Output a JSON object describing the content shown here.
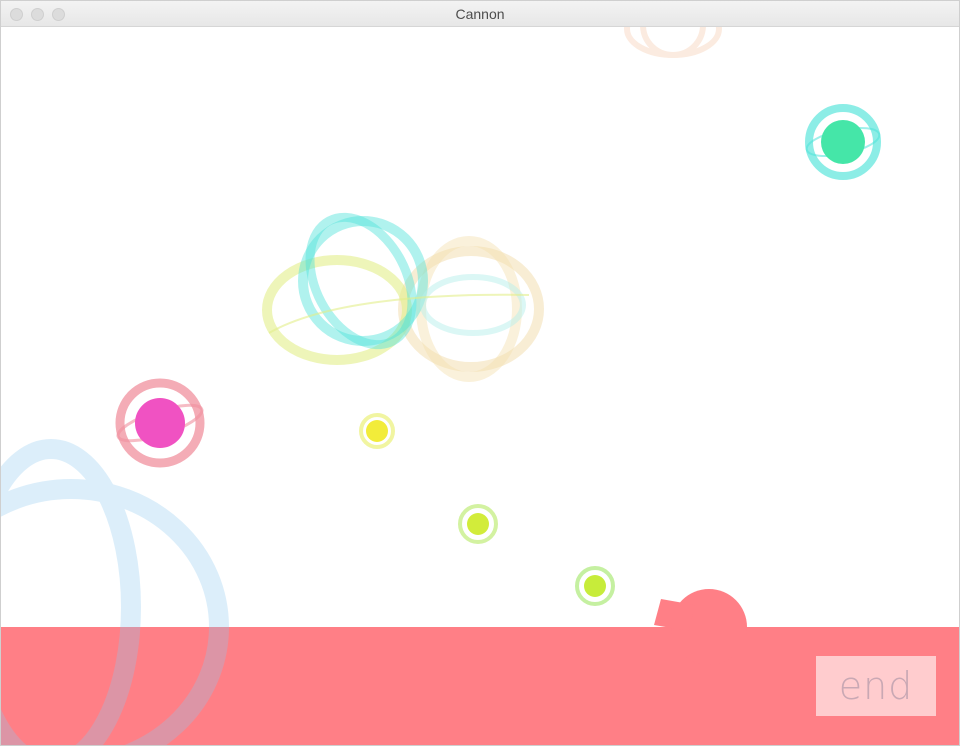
{
  "window": {
    "title": "Cannon"
  },
  "controls": {
    "end_label": "end"
  },
  "colors": {
    "ground": "#ff7f86",
    "cannon": "#ff7f86",
    "teal": "#45e6a8",
    "magenta": "#f052c2",
    "yellow": "#f2ec3a",
    "lime": "#d2ec3a",
    "aqua_ring": "#4fe3d9",
    "pink_ring": "#f0909e",
    "sky_ring": "#8fcaf0",
    "cream_ring": "#f3dfb0",
    "pale_yellow_ring": "#e2ef8a",
    "peach_ring": "#f5c7a8"
  }
}
